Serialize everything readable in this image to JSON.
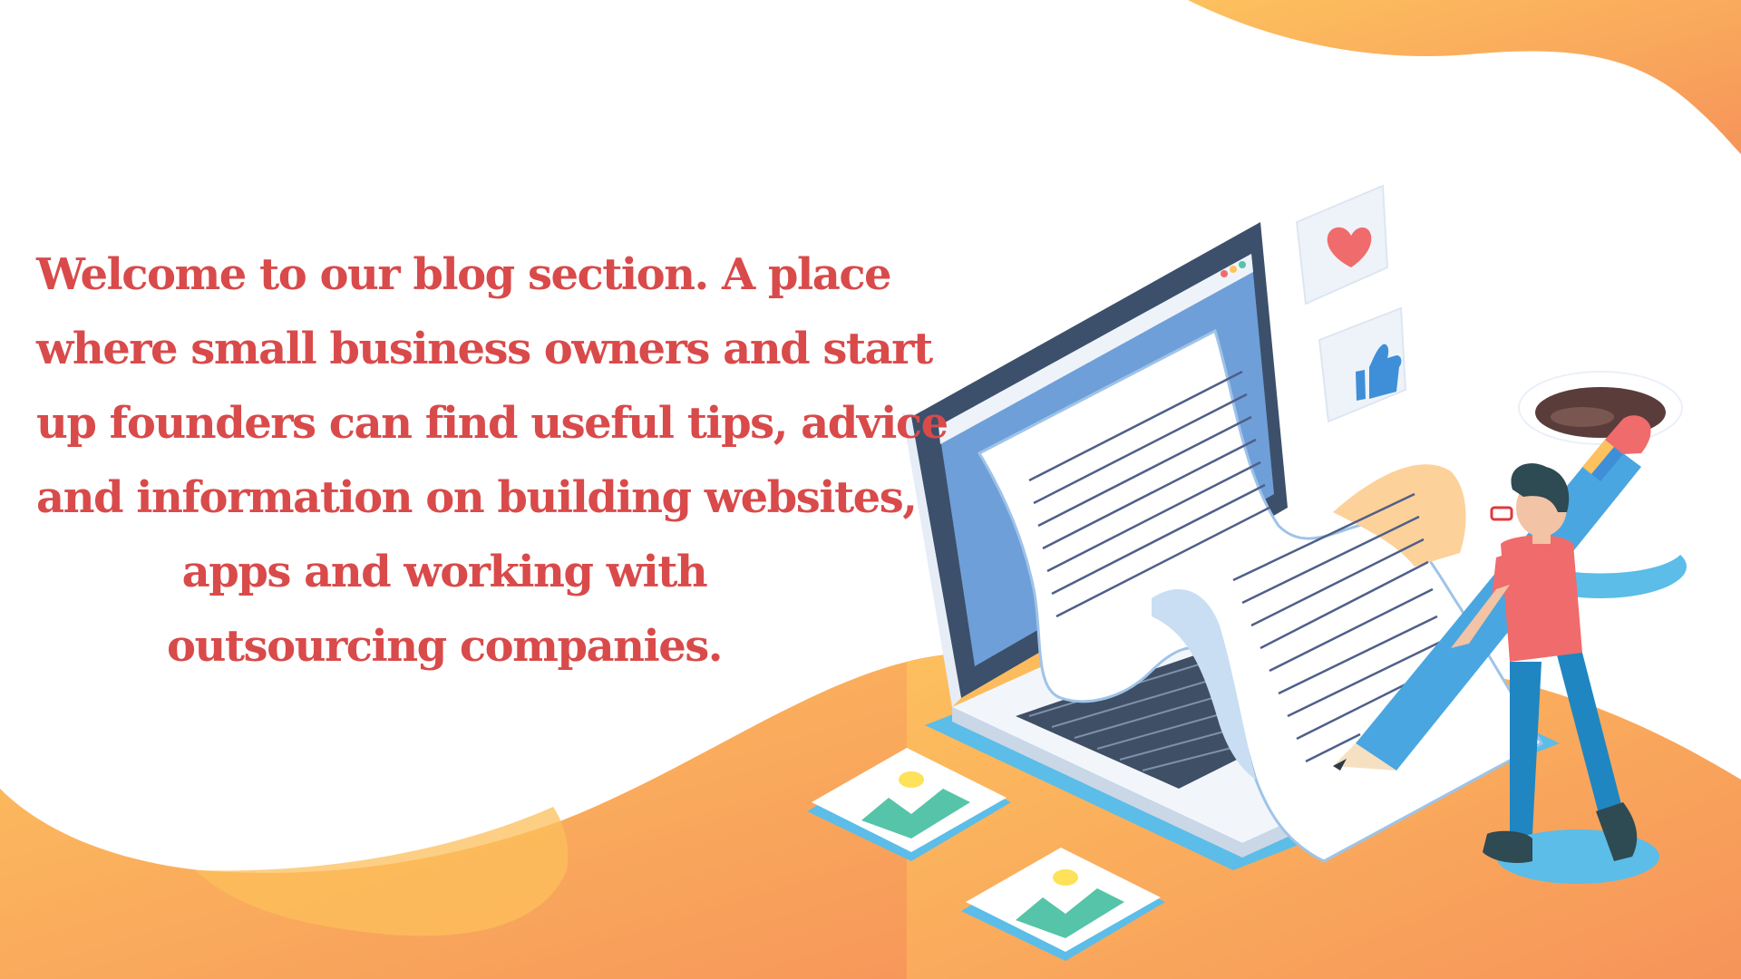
{
  "intro": {
    "lines": [
      "Welcome to our blog section. A place",
      "where small business owners and start",
      "up founders can find useful tips, advice",
      "and information on building websites,",
      "apps and working with",
      "outsourcing companies."
    ]
  },
  "colors": {
    "text": "#d94a4a",
    "orange_light": "#fdc15e",
    "orange_dark": "#f6945a",
    "laptop_frame": "#3c506b",
    "screen": "#6f9fd8",
    "shirt": "#f06b6b",
    "jeans": "#1f86c2",
    "image_green": "#55c4a8"
  },
  "illustration": {
    "icons": [
      "heart-icon",
      "thumbs-up-icon",
      "image-icon",
      "image-icon",
      "coffee-cup-icon",
      "pencil-icon"
    ]
  }
}
